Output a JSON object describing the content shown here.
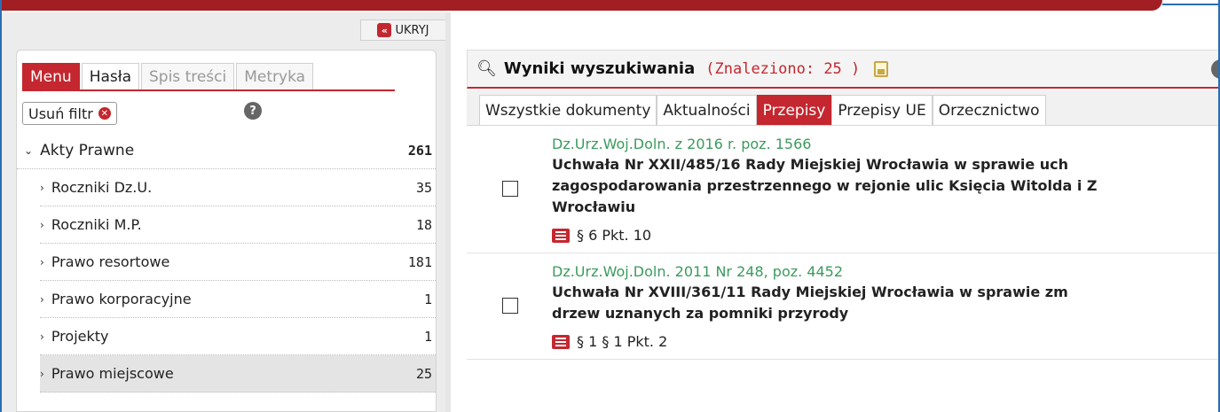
{
  "left_panel": {
    "hide_button": {
      "icon": "double-chevron-left-icon",
      "label": "UKRYJ"
    },
    "tabs": [
      {
        "label": "Menu",
        "state": "active"
      },
      {
        "label": "Hasła",
        "state": "normal"
      },
      {
        "label": "Spis treści",
        "state": "disabled"
      },
      {
        "label": "Metryka",
        "state": "disabled"
      }
    ],
    "filter_button": {
      "label": "Usuń filtr",
      "icon": "close-circle-icon"
    },
    "help_icon": "?",
    "tree": [
      {
        "label": "Akty Prawne",
        "count": "261",
        "level": 0,
        "expanded": true
      },
      {
        "label": "Roczniki Dz.U.",
        "count": "35",
        "level": 1
      },
      {
        "label": "Roczniki M.P.",
        "count": "18",
        "level": 1
      },
      {
        "label": "Prawo resortowe",
        "count": "181",
        "level": 1
      },
      {
        "label": "Prawo korporacyjne",
        "count": "1",
        "level": 1
      },
      {
        "label": "Projekty",
        "count": "1",
        "level": 1
      },
      {
        "label": "Prawo miejscowe",
        "count": "25",
        "level": 1,
        "selected": true
      }
    ]
  },
  "results_panel": {
    "title": "Wyniki wyszukiwania",
    "count_text": "(Znaleziono: 25 )",
    "help_icon": "?",
    "tabs": [
      {
        "label": "Wszystkie dokumenty",
        "active": false
      },
      {
        "label": "Aktualności",
        "active": false
      },
      {
        "label": "Przepisy",
        "active": true
      },
      {
        "label": "Przepisy UE",
        "active": false
      },
      {
        "label": "Orzecznictwo",
        "active": false
      }
    ],
    "results": [
      {
        "source": "Dz.Urz.Woj.Doln. z 2016 r. poz. 1566",
        "title": "Uchwała Nr XXII/485/16 Rady Miejskiej Wrocławia w sprawie uch\nzagospodarowania przestrzennego w rejonie ulic Księcia Witolda i Z\nWrocławiu",
        "reference": "§ 6 Pkt. 10"
      },
      {
        "source": "Dz.Urz.Woj.Doln. 2011 Nr 248, poz. 4452",
        "title": "Uchwała Nr XVIII/361/11 Rady Miejskiej Wrocławia w sprawie zm\ndrzew uznanych za pomniki przyrody",
        "reference": "§ 1 § 1 Pkt. 2"
      }
    ]
  },
  "colors": {
    "accent_red": "#c4272f",
    "source_green": "#3a9b5c",
    "frame_blue": "#2b6db5"
  }
}
